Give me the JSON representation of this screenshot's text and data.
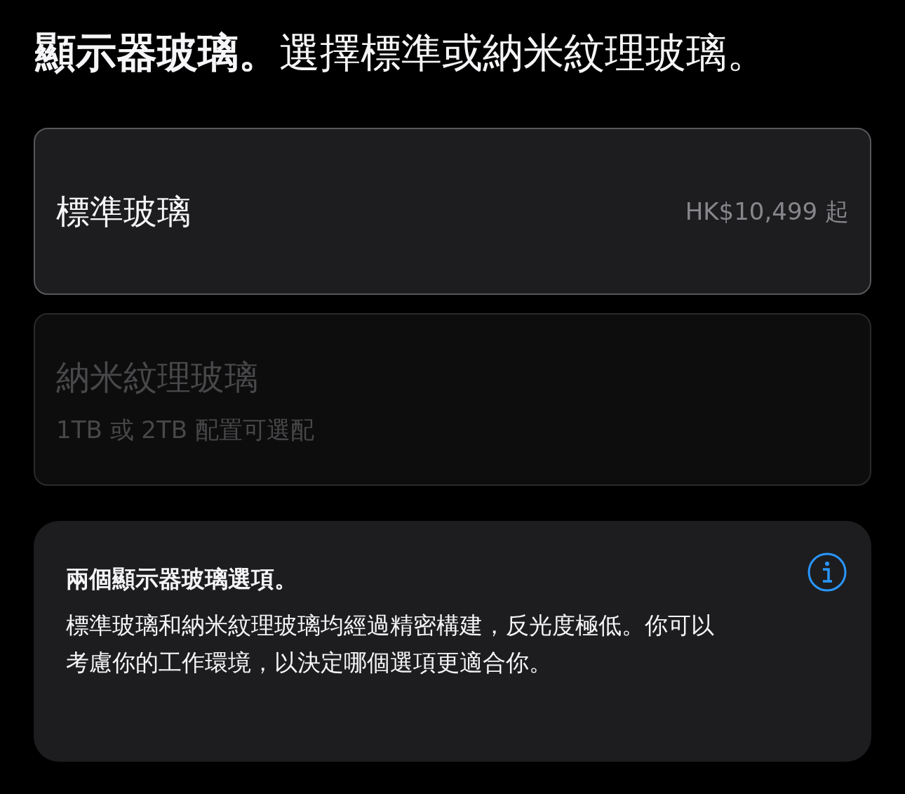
{
  "heading": "**顯示器玻璃。**選擇標準或納米紋理玻璃。",
  "options": [
    {
      "label": "標準玻璃",
      "price": "HK$10,499 起",
      "disabled": false
    },
    {
      "label": "納米紋理玻璃",
      "note": "1TB 或 2TB 配置可選配",
      "disabled": true
    }
  ],
  "info": {
    "title": "兩個顯示器玻璃選項。",
    "body": "標準玻璃和納米紋理玻璃均經過精密構建，反光度極低。你可以考慮你的工作環境，以決定哪個選項更適合你。"
  }
}
